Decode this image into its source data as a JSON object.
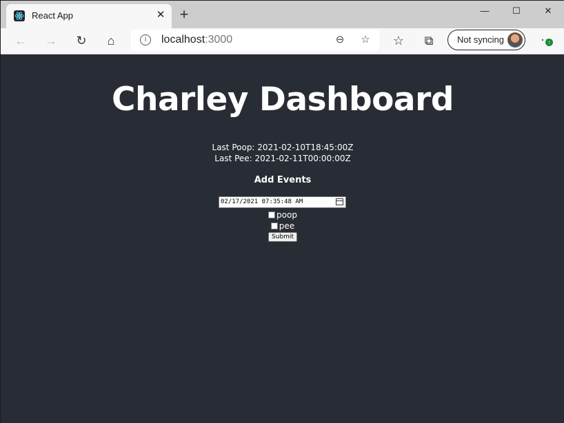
{
  "browser": {
    "tab": {
      "title": "React App",
      "close_glyph": "✕",
      "favicon": "react-icon"
    },
    "new_tab_glyph": "+",
    "window_controls": {
      "minimize": "—",
      "maximize": "☐",
      "close": "✕"
    },
    "toolbar": {
      "back_glyph": "←",
      "forward_glyph": "→",
      "refresh_glyph": "↻",
      "home_glyph": "⌂",
      "url_host": "localhost",
      "url_port": ":3000",
      "zoom_glyph": "⊖",
      "add_favorite_glyph": "☆",
      "favorites_glyph": "☆",
      "collections_glyph": "⧉",
      "profile_label": "Not syncing",
      "more_glyph": "···",
      "update_badge": "↑"
    }
  },
  "page": {
    "title": "Charley Dashboard",
    "last_poop": "Last Poop: 2021-02-10T18:45:00Z",
    "last_pee": "Last Pee: 2021-02-11T00:00:00Z",
    "add_events_heading": "Add Events",
    "datetime_value": "02/17/2021 07:35:48 AM",
    "checkboxes": [
      {
        "label": "poop",
        "checked": false
      },
      {
        "label": "pee",
        "checked": false
      }
    ],
    "submit_label": "Submit"
  },
  "colors": {
    "page_background": "#282c34",
    "text": "#ffffff",
    "tabstrip": "#cdcdcd",
    "toolbar": "#f7f7f7",
    "update_badge": "#1c8a3c"
  }
}
